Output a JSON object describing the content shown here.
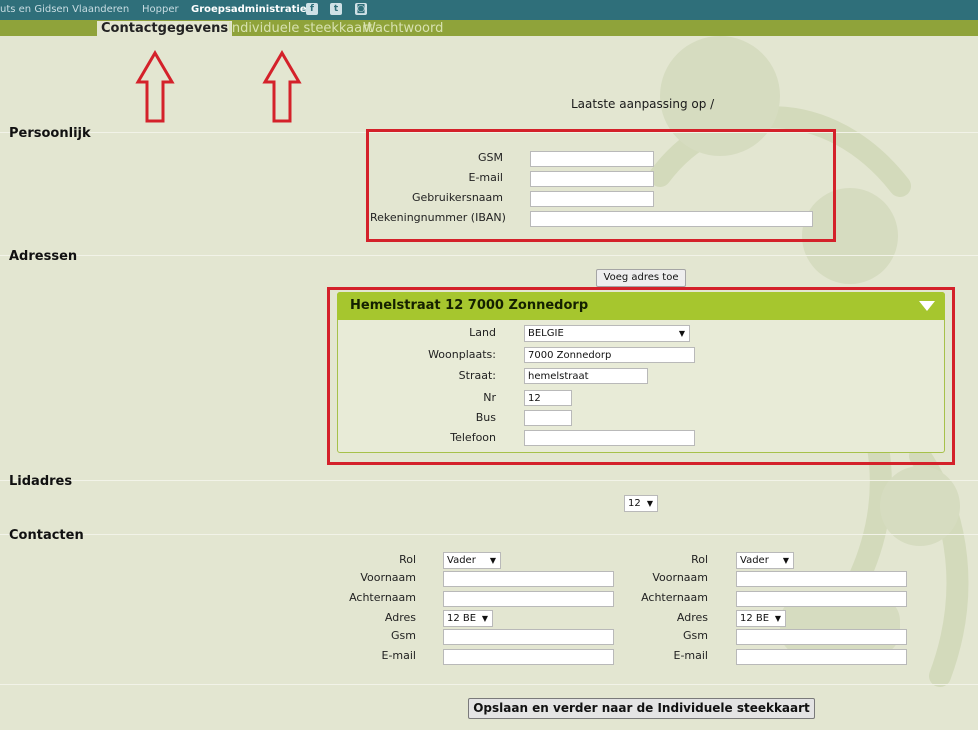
{
  "topbar": {
    "site_link": "uts en Gidsen Vlaanderen",
    "hopper_link": "Hopper",
    "groeps_link": "Groepsadministratie",
    "social": [
      "facebook-icon",
      "twitter-icon",
      "instagram-icon"
    ]
  },
  "tabs": [
    {
      "label": "Contactgegevens",
      "active": true
    },
    {
      "label": "Individuele steekkaart",
      "active": false
    },
    {
      "label": "Wachtwoord",
      "active": false
    }
  ],
  "last_modified": "Laatste aanpassing op /",
  "persoonlijk": {
    "title": "Persoonlijk",
    "gsm_label": "GSM",
    "email_label": "E-mail",
    "username_label": "Gebruikersnaam",
    "iban_label": "Rekeningnummer (IBAN)"
  },
  "adressen": {
    "title": "Adressen",
    "add_button": "Voeg adres toe",
    "address": {
      "header": "Hemelstraat 12 7000 Zonnedorp",
      "land_label": "Land",
      "land_value": "BELGIE",
      "woonplaats_label": "Woonplaats:",
      "woonplaats_value": "7000 Zonnedorp",
      "straat_label": "Straat:",
      "straat_value": "hemelstraat",
      "nr_label": "Nr",
      "nr_value": "12",
      "bus_label": "Bus",
      "telefoon_label": "Telefoon"
    }
  },
  "lidadres": {
    "title": "Lidadres",
    "value": "12"
  },
  "contacten": {
    "title": "Contacten",
    "contacts": [
      {
        "rol_label": "Rol",
        "rol_value": "Vader",
        "voornaam_label": "Voornaam",
        "achternaam_label": "Achternaam",
        "adres_label": "Adres",
        "adres_value": "12 BE",
        "gsm_label": "Gsm",
        "email_label": "E-mail"
      },
      {
        "rol_label": "Rol",
        "rol_value": "Vader",
        "voornaam_label": "Voornaam",
        "achternaam_label": "Achternaam",
        "adres_label": "Adres",
        "adres_value": "12 BE",
        "gsm_label": "Gsm",
        "email_label": "E-mail"
      }
    ]
  },
  "save_button": "Opslaan en verder naar de Individuele steekkaart",
  "colors": {
    "topbar": "#2f6f7a",
    "tabbar": "#8fa33a",
    "accent": "#a6c62e",
    "annotation": "#d4212a"
  }
}
